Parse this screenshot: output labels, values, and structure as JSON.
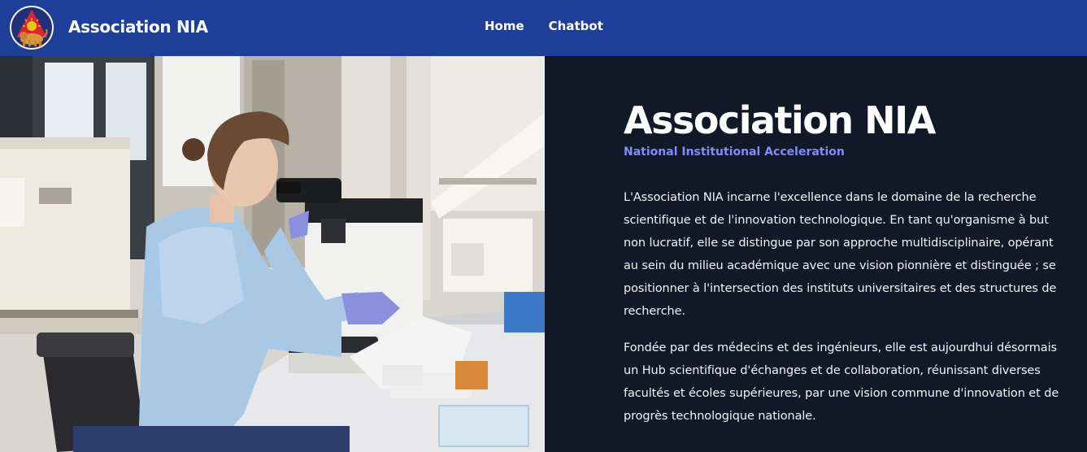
{
  "header": {
    "brand": "Association NIA",
    "logo_icon": "lion-emblem-icon",
    "nav": [
      {
        "label": "Home"
      },
      {
        "label": "Chatbot"
      }
    ]
  },
  "hero": {
    "image_icon": "laboratory-microscope-photo",
    "title": "Association NIA",
    "subtitle": "National Institutional Acceleration",
    "paragraphs": [
      "L'Association NIA incarne l'excellence dans le domaine de la recherche scientifique et de l'innovation technologique. En tant qu'organisme à but non lucratif, elle se distingue par son approche multidisciplinaire, opérant au sein du milieu académique avec une vision pionnière et distinguée ; se positionner à l'intersection des instituts universitaires et des structures de recherche.",
      "Fondée par des médecins et des ingénieurs, elle est aujourdhui désormais un Hub scientifique d'échanges et de collaboration, réunissant diverses facultés et écoles supérieures, par une vision commune d'innovation et de progrès technologique nationale."
    ]
  },
  "colors": {
    "navbar": "#1e3f99",
    "background": "#111827",
    "accent": "#818cf8"
  }
}
